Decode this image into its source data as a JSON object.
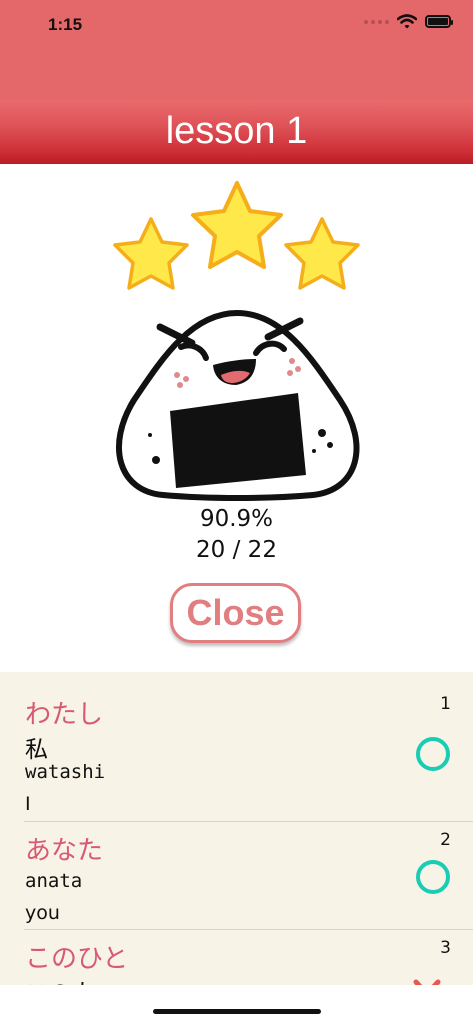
{
  "status_bar": {
    "time": "1:15"
  },
  "nav": {
    "title": "lesson 1"
  },
  "result": {
    "stars_earned": 3,
    "stars_total": 3,
    "percentage": "90.9%",
    "score": "20 / 22",
    "close_label": "Close"
  },
  "vocab": [
    {
      "number": "1",
      "kana": "わたし",
      "kanji": "私",
      "romaji": "watashi",
      "meaning": "I",
      "result": "correct-circle"
    },
    {
      "number": "2",
      "kana": "あなた",
      "kanji": "",
      "romaji": "anata",
      "meaning": "you",
      "result": "correct-circle"
    },
    {
      "number": "3",
      "kana": "このひと",
      "kanji": "この人",
      "romaji": "",
      "meaning": "",
      "result": "incorrect-cross"
    }
  ],
  "colors": {
    "header": "#e4676a",
    "nav_gradient_bottom": "#b91c26",
    "kana": "#d75a73",
    "correct": "#19ccb4",
    "incorrect": "#e8584f",
    "list_bg": "#f7f3e6",
    "star": "#ffe84a"
  }
}
